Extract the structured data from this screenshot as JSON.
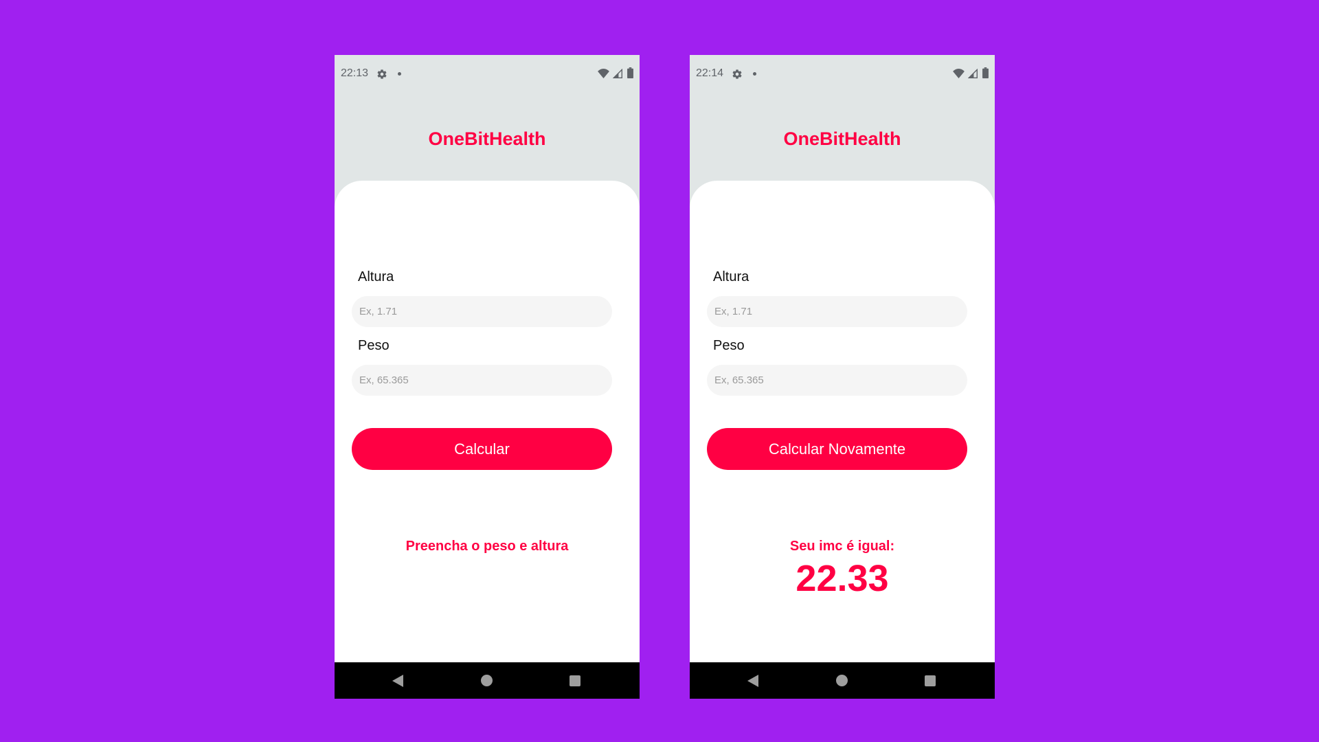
{
  "colors": {
    "background": "#a020f0",
    "accent": "#ff0043",
    "header": "#e1e6e6"
  },
  "screens": [
    {
      "status_bar": {
        "time": "22:13",
        "icons": [
          "gear-icon",
          "notification-dot-icon",
          "wifi-icon",
          "signal-icon",
          "battery-icon"
        ]
      },
      "app_title": "OneBitHealth",
      "form": {
        "height_label": "Altura",
        "height_placeholder": "Ex, 1.71",
        "height_value": "",
        "weight_label": "Peso",
        "weight_placeholder": "Ex, 65.365",
        "weight_value": ""
      },
      "button_label": "Calcular",
      "message": "Preencha o peso e altura",
      "result_value": "",
      "nav_bar": {
        "icons": [
          "back-icon",
          "home-icon",
          "recents-icon"
        ]
      }
    },
    {
      "status_bar": {
        "time": "22:14",
        "icons": [
          "gear-icon",
          "notification-dot-icon",
          "wifi-icon",
          "signal-icon",
          "battery-icon"
        ]
      },
      "app_title": "OneBitHealth",
      "form": {
        "height_label": "Altura",
        "height_placeholder": "Ex, 1.71",
        "height_value": "",
        "weight_label": "Peso",
        "weight_placeholder": "Ex, 65.365",
        "weight_value": ""
      },
      "button_label": "Calcular Novamente",
      "message": "Seu imc é igual:",
      "result_value": "22.33",
      "nav_bar": {
        "icons": [
          "back-icon",
          "home-icon",
          "recents-icon"
        ]
      }
    }
  ]
}
